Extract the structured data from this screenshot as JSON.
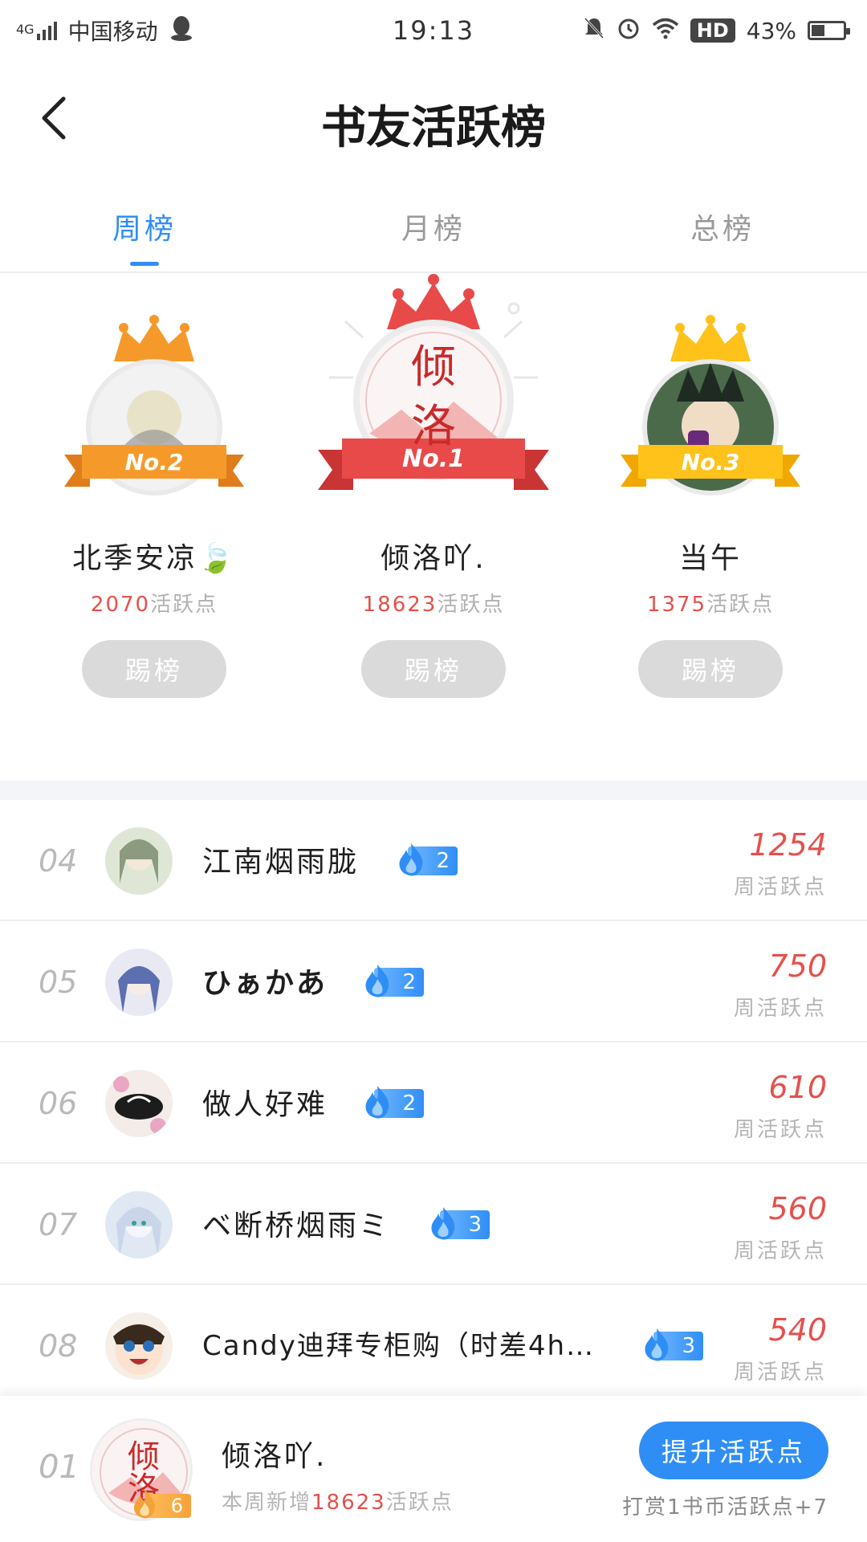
{
  "status_bar": {
    "signal": "4G",
    "carrier": "中国移动",
    "time": "19:13",
    "hd": "HD",
    "battery": "43%",
    "battery_level": 0.43
  },
  "header": {
    "title": "书友活跃榜"
  },
  "tabs": [
    {
      "label": "周榜",
      "active": true
    },
    {
      "label": "月榜",
      "active": false
    },
    {
      "label": "总榜",
      "active": false
    }
  ],
  "podium": {
    "first": {
      "rank": "No.1",
      "name": "倾洛吖.",
      "points": "18623",
      "unit": "活跃点",
      "kick": "踢榜",
      "avatar_text": "倾洛"
    },
    "second": {
      "rank": "No.2",
      "name": "北季安凉🍃",
      "points": "2070",
      "unit": "活跃点",
      "kick": "踢榜"
    },
    "third": {
      "rank": "No.3",
      "name": "当午",
      "points": "1375",
      "unit": "活跃点",
      "kick": "踢榜"
    }
  },
  "colors": {
    "accent": "#2f8ef5",
    "gold": "#ffc21a",
    "silver_orange": "#f59a2a",
    "first_red": "#e84a4a",
    "points_red": "#e5504c"
  },
  "list": [
    {
      "rank": "04",
      "name": "江南烟雨胧",
      "level": "2",
      "score": "1254",
      "unit": "周活跃点"
    },
    {
      "rank": "05",
      "name": "ひぁかあ",
      "level": "2",
      "score": "750",
      "unit": "周活跃点"
    },
    {
      "rank": "06",
      "name": "做人好难",
      "level": "2",
      "score": "610",
      "unit": "周活跃点"
    },
    {
      "rank": "07",
      "name": "ベ断桥烟雨ミ",
      "level": "3",
      "score": "560",
      "unit": "周活跃点"
    },
    {
      "rank": "08",
      "name": "Candy迪拜专柜购（时差4h…",
      "level": "3",
      "score": "540",
      "unit": "周活跃点"
    }
  ],
  "me": {
    "rank": "01",
    "name": "倾洛吖.",
    "level": "6",
    "sub_prefix": "本周新增",
    "sub_points": "18623",
    "sub_unit": "活跃点",
    "boost_label": "提升活跃点",
    "boost_note": "打赏1书币活跃点+7"
  }
}
